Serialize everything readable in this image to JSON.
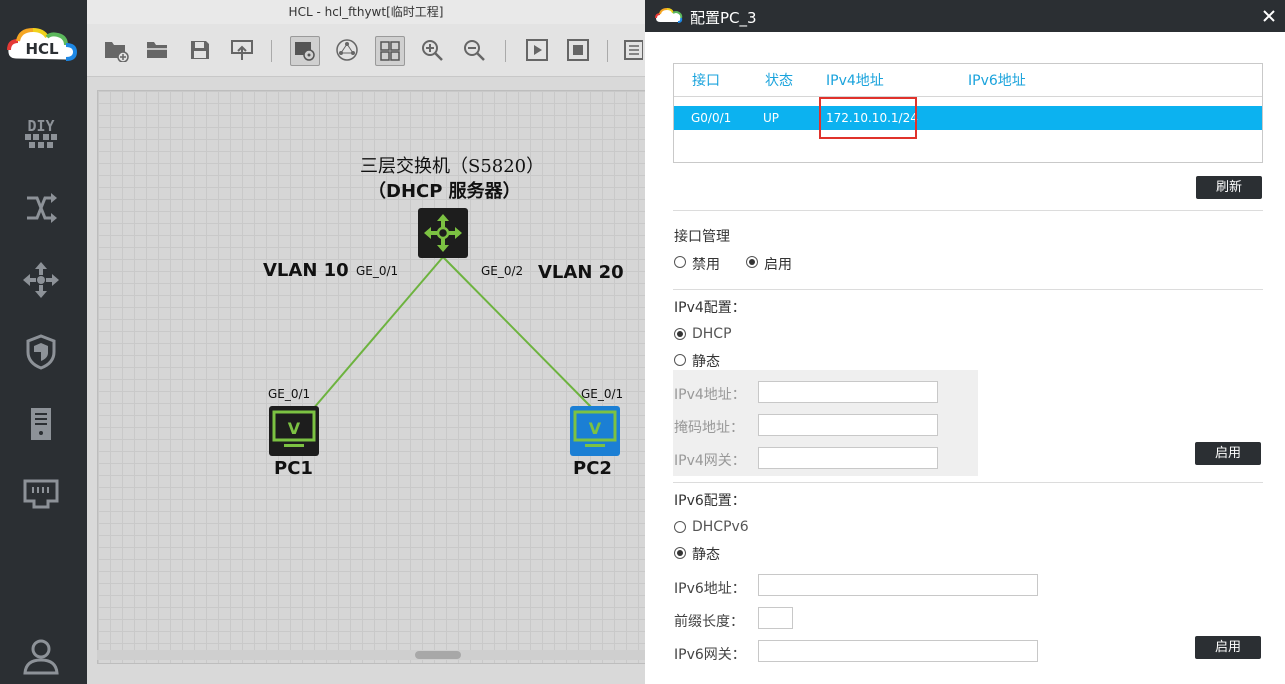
{
  "colors": {
    "accent": "#0cb2f0",
    "highlight_box": "#e0322b",
    "dark": "#2b2f33",
    "link_line": "#6db33f"
  },
  "main_window": {
    "title": "HCL - hcl_fthywt[临时工程]"
  },
  "sidebar": {
    "logo_text": "HCL",
    "items": [
      {
        "icon": "diy-icon",
        "label": "DIY"
      },
      {
        "icon": "router-icon"
      },
      {
        "icon": "switch-icon"
      },
      {
        "icon": "firewall-icon"
      },
      {
        "icon": "server-icon"
      },
      {
        "icon": "terminal-icon"
      },
      {
        "icon": "user-icon"
      }
    ]
  },
  "toolbar": {
    "items": [
      "new-project-icon",
      "open-project-icon",
      "save-icon",
      "export-icon",
      "screenshot-icon",
      "topology-icon",
      "grid-icon",
      "zoom-in-icon",
      "zoom-out-icon",
      "start-icon",
      "stop-icon",
      "list-icon"
    ]
  },
  "topology": {
    "switch_title_line1": "三层交换机（S5820）",
    "switch_title_line2": "（DHCP 服务器）",
    "vlan_left": "VLAN 10",
    "vlan_right": "VLAN 20",
    "sw_port_left": "GE_0/1",
    "sw_port_right": "GE_0/2",
    "pc1_port": "GE_0/1",
    "pc2_port": "GE_0/1",
    "pc1_name": "PC1",
    "pc2_name": "PC2",
    "pc_screen_glyph": "V"
  },
  "dialog": {
    "title": "配置PC_3",
    "interface_table": {
      "headers": [
        "接口",
        "状态",
        "IPv4地址",
        "IPv6地址"
      ],
      "rows": [
        {
          "interface": "G0/0/1",
          "status": "UP",
          "ipv4": "172.10.10.1/24",
          "ipv6": ""
        }
      ]
    },
    "refresh_button": "刷新",
    "interface_mgmt": {
      "title": "接口管理",
      "options": [
        "禁用",
        "启用"
      ],
      "selected": "启用"
    },
    "ipv4": {
      "title": "IPv4配置：",
      "options": [
        "DHCP",
        "静态"
      ],
      "selected": "DHCP",
      "address_label": "IPv4地址：",
      "mask_label": "掩码地址：",
      "gateway_label": "IPv4网关：",
      "address_value": "",
      "mask_value": "",
      "gateway_value": "",
      "apply_button": "启用"
    },
    "ipv6": {
      "title": "IPv6配置：",
      "options": [
        "DHCPv6",
        "静态"
      ],
      "selected": "静态",
      "address_label": "IPv6地址：",
      "prefix_label": "前缀长度：",
      "gateway_label": "IPv6网关：",
      "address_value": "",
      "prefix_value": "",
      "gateway_value": "",
      "apply_button": "启用"
    }
  }
}
